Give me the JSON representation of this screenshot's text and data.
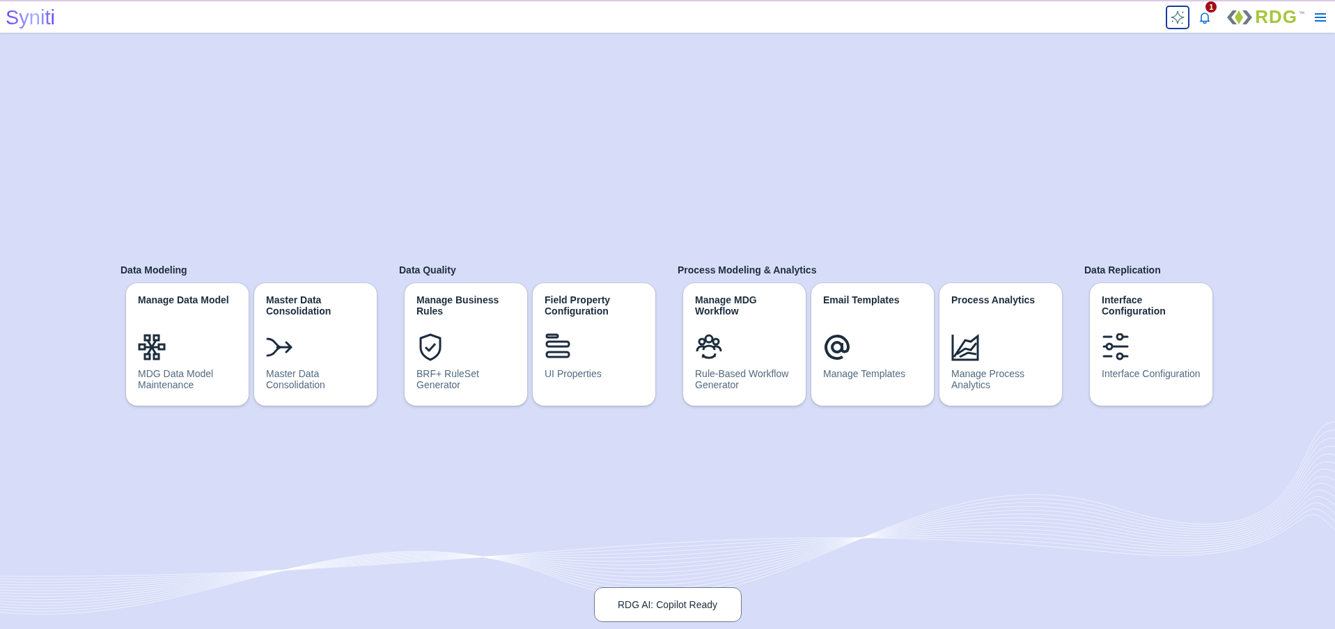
{
  "header": {
    "logo": "Syniti",
    "notifications_badge": "1",
    "brand": "RDG",
    "brand_mark": "™"
  },
  "groups": [
    {
      "title": "Data Modeling",
      "tiles": [
        {
          "title": "Manage Data Model",
          "subtitle": "MDG Data Model Maintenance",
          "kind": "network"
        },
        {
          "title": "Master Data Consolidation",
          "subtitle": "Master Data Consolidation",
          "kind": "merge"
        }
      ]
    },
    {
      "title": "Data Quality",
      "tiles": [
        {
          "title": "Manage Business Rules",
          "subtitle": "BRF+ RuleSet Generator",
          "kind": "shield"
        },
        {
          "title": "Field Property Configuration",
          "subtitle": "UI Properties",
          "kind": "bars"
        }
      ]
    },
    {
      "title": "Process Modeling & Analytics",
      "tiles": [
        {
          "title": "Manage MDG Workflow",
          "subtitle": "Rule-Based Workflow Generator",
          "kind": "people"
        },
        {
          "title": "Email Templates",
          "subtitle": "Manage Templates",
          "kind": "at"
        },
        {
          "title": "Process Analytics",
          "subtitle": "Manage Process Analytics",
          "kind": "chart"
        }
      ]
    },
    {
      "title": "Data Replication",
      "tiles": [
        {
          "title": "Interface Configuration",
          "subtitle": "Interface Configuration",
          "kind": "sliders"
        }
      ]
    }
  ],
  "copilot_button": "RDG AI: Copilot Ready"
}
